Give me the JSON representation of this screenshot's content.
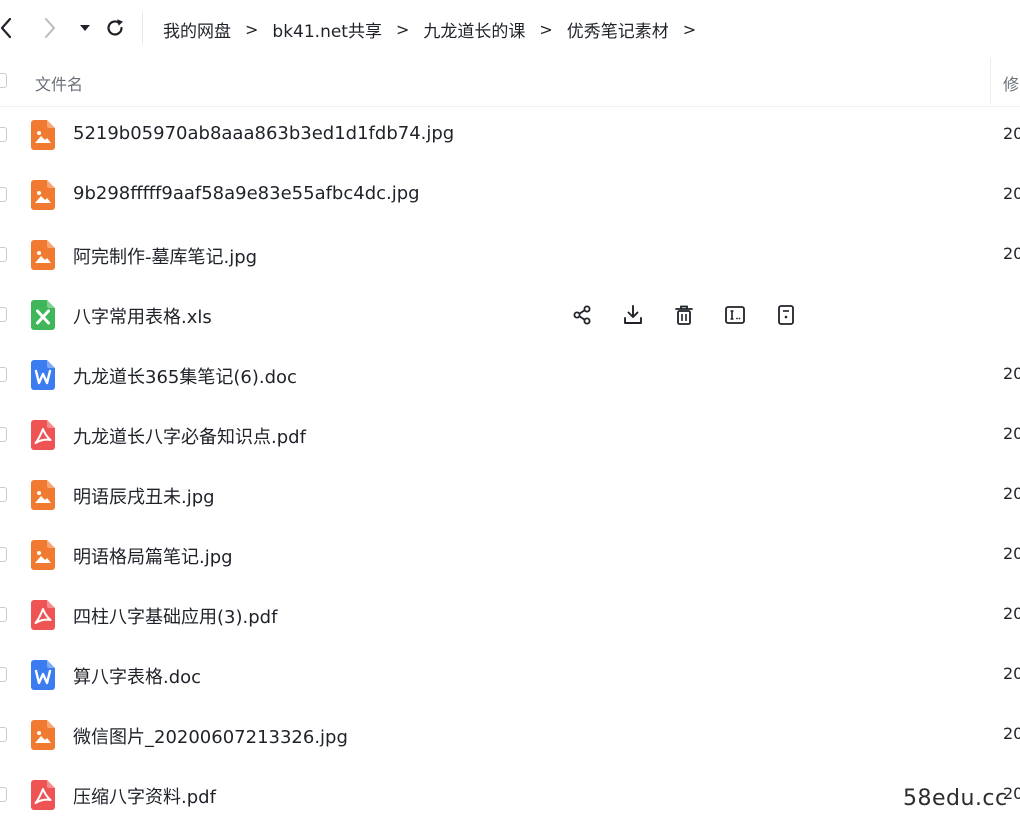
{
  "nav": {
    "back_icon": "chevron-left-icon",
    "forward_icon": "chevron-right-icon",
    "history_icon": "caret-down-icon",
    "refresh_icon": "refresh-icon"
  },
  "breadcrumb": {
    "items": [
      "我的网盘",
      "bk41.net共享",
      "九龙道长的课",
      "优秀笔记素材"
    ],
    "separator": ">"
  },
  "header": {
    "name_label": "文件名",
    "modified_label": "修"
  },
  "files": [
    {
      "name": "5219b05970ab8aaa863b3ed1d1fdb74.jpg",
      "type": "image",
      "date": "20"
    },
    {
      "name": "9b298fffff9aaf58a9e83e55afbc4dc.jpg",
      "type": "image",
      "date": "20"
    },
    {
      "name": "阿完制作-墓库笔记.jpg",
      "type": "image",
      "date": "20"
    },
    {
      "name": "八字常用表格.xls",
      "type": "excel",
      "date": ""
    },
    {
      "name": "九龙道长365集笔记(6).doc",
      "type": "word",
      "date": "20"
    },
    {
      "name": "九龙道长八字必备知识点.pdf",
      "type": "pdf",
      "date": "20"
    },
    {
      "name": "明语辰戌丑未.jpg",
      "type": "image",
      "date": "20"
    },
    {
      "name": "明语格局篇笔记.jpg",
      "type": "image",
      "date": "20"
    },
    {
      "name": "四柱八字基础应用(3).pdf",
      "type": "pdf",
      "date": "20"
    },
    {
      "name": "算八字表格.doc",
      "type": "word",
      "date": "20"
    },
    {
      "name": "微信图片_20200607213326.jpg",
      "type": "image",
      "date": "20"
    },
    {
      "name": "压缩八字资料.pdf",
      "type": "pdf",
      "date": "20"
    }
  ],
  "row_actions": [
    "share-icon",
    "download-icon",
    "delete-icon",
    "rename-icon",
    "more-icon"
  ],
  "colors": {
    "image": "#f07a2f",
    "excel": "#3fb65a",
    "word": "#3b7df0",
    "pdf": "#ee5454"
  },
  "watermark": "58edu.cc"
}
